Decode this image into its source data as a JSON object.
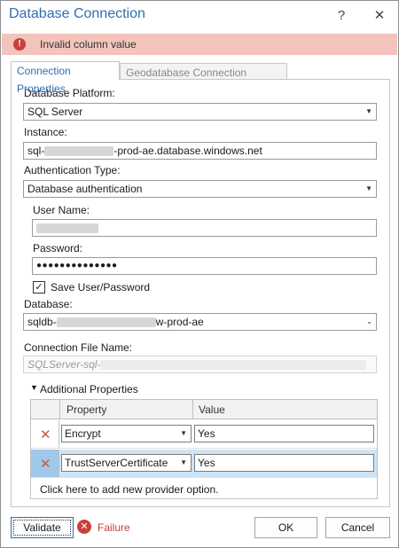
{
  "window": {
    "title": "Database Connection",
    "help": "?",
    "close": "✕"
  },
  "error": {
    "icon": "error-icon",
    "message": "Invalid column value",
    "color": "#c9403a"
  },
  "tabs": [
    {
      "label": "Connection Properties",
      "active": true
    },
    {
      "label": "Geodatabase Connection Properties",
      "active": false
    }
  ],
  "form": {
    "platform_label": "Database Platform:",
    "platform_value": "SQL Server",
    "instance_label": "Instance:",
    "instance_prefix": "sql-",
    "instance_suffix": "-prod-ae.database.windows.net",
    "auth_label": "Authentication Type:",
    "auth_value": "Database authentication",
    "user_label": "User Name:",
    "password_label": "Password:",
    "password_value": "●●●●●●●●●●●●●●",
    "save_label": "Save User/Password",
    "save_checked": true,
    "database_label": "Database:",
    "database_prefix": "sqldb-",
    "database_suffix": "w-prod-ae",
    "conn_file_label": "Connection File Name:",
    "conn_file_value": "SQLServer-sql-",
    "additional_label": "Additional Properties"
  },
  "table": {
    "headers": [
      "Property",
      "Value"
    ],
    "rows": [
      {
        "property": "Encrypt",
        "value": "Yes",
        "selected": false
      },
      {
        "property": "TrustServerCertificate",
        "value": "Yes",
        "selected": true
      }
    ],
    "add_text": "Click here to add new provider option."
  },
  "footer": {
    "validate_label": "Validate",
    "status_icon": "failure-icon",
    "status_text": "Failure",
    "ok_label": "OK",
    "cancel_label": "Cancel"
  }
}
